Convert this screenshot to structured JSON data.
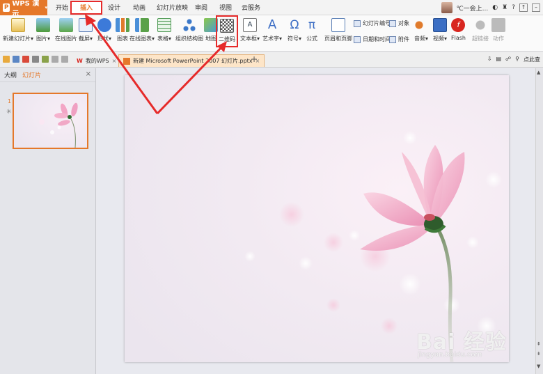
{
  "app": {
    "name": "WPS 演示"
  },
  "menu": {
    "items": [
      "开始",
      "插入",
      "设计",
      "动画",
      "幻灯片放映",
      "审阅",
      "视图",
      "云服务"
    ],
    "active": "插入"
  },
  "user": {
    "name": "℃一会上..."
  },
  "ribbon": {
    "new_slide": "新建幻灯片",
    "picture": "图片",
    "online_picture": "在线图片",
    "screenshot": "截屏",
    "shape": "形状",
    "chart": "图表",
    "online_chart": "在线图表",
    "table": "表格",
    "org_chart": "组织结构图",
    "map": "地图",
    "qrcode": "二维码",
    "textbox": "文本框",
    "wordart": "艺术字",
    "symbol": "符号",
    "formula": "公式",
    "header_footer": "页眉和页脚",
    "slide_number": "幻灯片编号",
    "object": "对象",
    "date_time": "日期和时间",
    "attachment": "附件",
    "audio": "音频",
    "video": "视频",
    "flash": "Flash",
    "hyperlink": "超链接",
    "action": "动作"
  },
  "tabs": {
    "mywps": "我的WPS",
    "document": "新建 Microsoft PowerPoint 2007 幻灯片.pptx",
    "right_hint": "点此查"
  },
  "leftpanel": {
    "outline": "大纲",
    "slides": "幻灯片",
    "slide_number": "1"
  },
  "watermark": {
    "brand": "Bai 经验",
    "url": "jingyan.baidu.com"
  },
  "colors": {
    "accent": "#e5782a",
    "highlight": "#e62a2a"
  }
}
